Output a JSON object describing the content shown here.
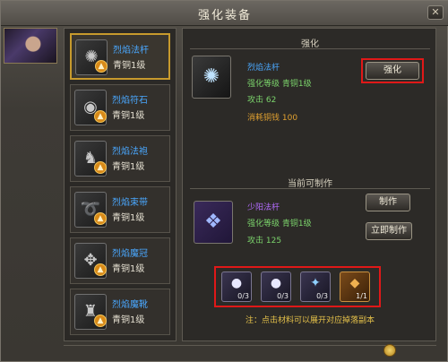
{
  "window": {
    "title": "强化装备",
    "close_glyph": "✕"
  },
  "items": [
    {
      "name": "烈焰法杆",
      "grade": "青铜1级",
      "icon": "fan-icon",
      "glyph": "✺"
    },
    {
      "name": "烈焰符石",
      "grade": "青铜1级",
      "icon": "charm-icon",
      "glyph": "◉"
    },
    {
      "name": "烈焰法袍",
      "grade": "青铜1级",
      "icon": "robe-icon",
      "glyph": "♞"
    },
    {
      "name": "烈焰束带",
      "grade": "青铜1级",
      "icon": "belt-icon",
      "glyph": "➰"
    },
    {
      "name": "烈焰魔冠",
      "grade": "青铜1级",
      "icon": "crown-icon",
      "glyph": "✥"
    },
    {
      "name": "烈焰魔靴",
      "grade": "青铜1级",
      "icon": "boots-icon",
      "glyph": "♜"
    }
  ],
  "upgrade_badge": "▲",
  "enhance": {
    "header": "强化",
    "item_name": "烈焰法杆",
    "level_line": "强化等级  青铜1级",
    "attack_line": "攻击  62",
    "cost_line": "消耗铜钱  100",
    "button": "强化",
    "glyph": "✺"
  },
  "craft": {
    "header": "当前可制作",
    "item_name": "少阳法杆",
    "level_line": "强化等级  青铜1级",
    "attack_line": "攻击  125",
    "make_button": "制作",
    "instant_button": "立即制作",
    "glyph": "❖"
  },
  "materials": [
    {
      "icon": "pearl-icon",
      "glyph": "●",
      "count": "0/3"
    },
    {
      "icon": "pearl-icon",
      "glyph": "●",
      "count": "0/3"
    },
    {
      "icon": "crystal-icon",
      "glyph": "✦",
      "count": "0/3"
    },
    {
      "icon": "amber-icon",
      "glyph": "◆",
      "count": "1/1"
    }
  ],
  "note": "注：点击材料可以展开对应掉落副本",
  "colors": {
    "highlight_red": "#e01818",
    "selected_gold": "#c79a2d",
    "name_blue": "#4aa8ff",
    "note_yellow": "#e6c24a"
  }
}
